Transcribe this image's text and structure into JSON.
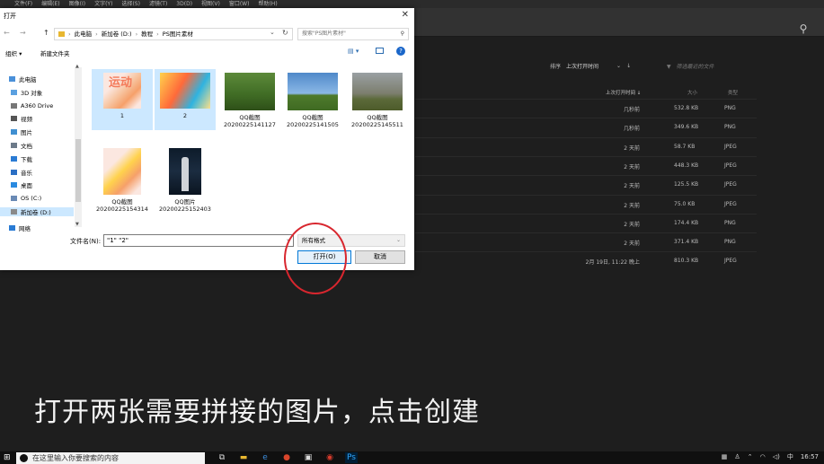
{
  "menubar": {
    "items": [
      "文件(F)",
      "编辑(E)",
      "图像(I)",
      "文字(Y)",
      "选择(S)",
      "滤镜(T)",
      "3D(D)",
      "视图(V)",
      "窗口(W)",
      "帮助(H)"
    ]
  },
  "photoshop": {
    "sort_label": "排序",
    "sort_value": "上次打开时间",
    "filter_placeholder": "筛选最近的文件",
    "col_last_opened": "上次打开时间 ↓",
    "col_size": "大小",
    "col_type": "类型",
    "rows": [
      {
        "time": "几秒前",
        "size": "532.8 KB",
        "type": "PNG"
      },
      {
        "time": "几秒前",
        "size": "349.6 KB",
        "type": "PNG"
      },
      {
        "time": "2 天前",
        "size": "58.7 KB",
        "type": "JPEG"
      },
      {
        "time": "2 天前",
        "size": "448.3 KB",
        "type": "JPEG"
      },
      {
        "time": "2 天前",
        "size": "125.5 KB",
        "type": "JPEG"
      },
      {
        "time": "2 天前",
        "size": "75.0 KB",
        "type": "JPEG"
      },
      {
        "time": "2 天前",
        "size": "174.4 KB",
        "type": "PNG"
      },
      {
        "time": "2 天前",
        "size": "371.4 KB",
        "type": "PNG"
      },
      {
        "time": "2月 19日, 11:22 晚上",
        "size": "810.3 KB",
        "type": "JPEG"
      }
    ]
  },
  "dialog": {
    "title": "打开",
    "address": [
      "此电脑",
      "新加卷 (D:)",
      "教程",
      "PS图片素材"
    ],
    "search_placeholder": "搜索\"PS图片素材\"",
    "organize": "组织 ▾",
    "new_folder": "新建文件夹",
    "nav": [
      {
        "label": "此电脑",
        "icon": "computer-icon",
        "color": "#4a90d9"
      },
      {
        "label": "3D 对象",
        "icon": "3d-objects-icon",
        "color": "#5aa0e0"
      },
      {
        "label": "A360 Drive",
        "icon": "cloud-drive-icon",
        "color": "#777777"
      },
      {
        "label": "视频",
        "icon": "video-icon",
        "color": "#555555"
      },
      {
        "label": "图片",
        "icon": "pictures-icon",
        "color": "#3f8fd1"
      },
      {
        "label": "文档",
        "icon": "documents-icon",
        "color": "#6c7a89"
      },
      {
        "label": "下载",
        "icon": "download-icon",
        "color": "#2a7bd4"
      },
      {
        "label": "音乐",
        "icon": "music-icon",
        "color": "#2a6fc4"
      },
      {
        "label": "桌面",
        "icon": "desktop-icon",
        "color": "#2a8ae0"
      },
      {
        "label": "OS (C:)",
        "icon": "drive-icon",
        "color": "#6a8ab5"
      },
      {
        "label": "新加卷 (D:)",
        "icon": "drive-icon",
        "color": "#8a8a8a"
      },
      {
        "label": "网络",
        "icon": "network-icon",
        "color": "#2a7bd4"
      }
    ],
    "files": [
      {
        "name": "1",
        "selected": true
      },
      {
        "name": "2",
        "selected": true
      },
      {
        "name": "QQ截图\n20200225141127",
        "selected": false
      },
      {
        "name": "QQ截图\n20200225141505",
        "selected": false
      },
      {
        "name": "QQ截图\n20200225145511",
        "selected": false
      },
      {
        "name": "QQ截图\n20200225154314",
        "selected": false
      },
      {
        "name": "QQ图片\n20200225152403",
        "selected": false
      }
    ],
    "thumb1_text": "运动",
    "filename_label": "文件名(N):",
    "filename_value": "\"1\" \"2\"",
    "filetype": "所有格式",
    "open_button": "打开(O)",
    "cancel_button": "取消"
  },
  "subtitle": "打开两张需要拼接的图片，点击创建",
  "taskbar": {
    "search_placeholder": "在这里输入你要搜索的内容",
    "time": "16:57"
  }
}
